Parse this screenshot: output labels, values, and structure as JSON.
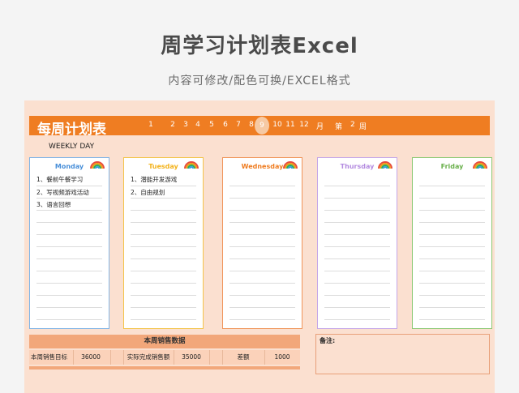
{
  "header": {
    "title": "周学习计划表Excel",
    "subtitle": "内容可修改/配色可换/EXCEL格式"
  },
  "sheet": {
    "banner_title": "每周计划表",
    "months": [
      "1",
      "2",
      "3",
      "4",
      "5",
      "6",
      "7",
      "8",
      "9",
      "10",
      "11",
      "12"
    ],
    "selected_month": "9",
    "month_label": "月",
    "week_prefix": "第",
    "week_value": "2",
    "week_suffix": "周",
    "weekly_day_label": "WEEKLY DAY"
  },
  "days": [
    {
      "name": "Monday",
      "color": "#4a90d9",
      "tasks": [
        "1、餐前午餐学习",
        "2、写视频游戏活动",
        "3、语言回想"
      ]
    },
    {
      "name": "Tuesday",
      "color": "#f3b21a",
      "tasks": [
        "1、潜能开发游戏",
        "2、自由规划"
      ]
    },
    {
      "name": "Wednesday",
      "color": "#ef7d22",
      "tasks": []
    },
    {
      "name": "Thursday",
      "color": "#b48be0",
      "tasks": []
    },
    {
      "name": "Friday",
      "color": "#6ab04c",
      "tasks": []
    }
  ],
  "sales": {
    "heading": "本周销售数据",
    "target_label": "本周销售目标",
    "target_value": "36000",
    "actual_label": "实际完成销售额",
    "actual_value": "35000",
    "diff_label": "差额",
    "diff_value": "1000"
  },
  "notes": {
    "label": "备注:"
  }
}
